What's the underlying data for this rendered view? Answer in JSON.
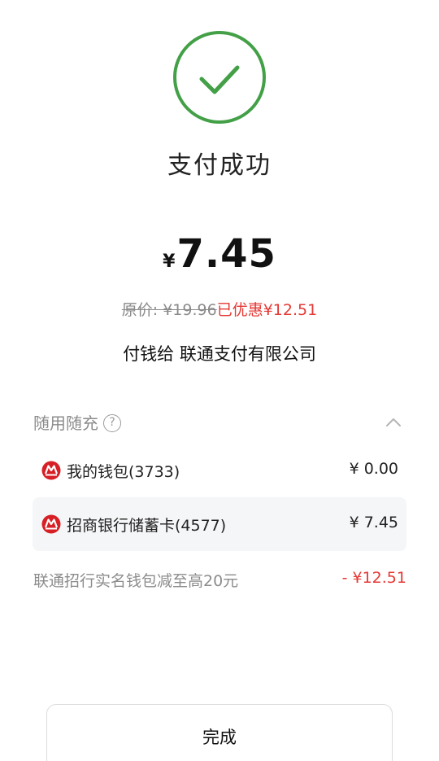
{
  "status": {
    "title": "支付成功",
    "icon": "check-circle-icon",
    "color": "#43a047"
  },
  "payment": {
    "currency_symbol": "¥",
    "amount": "7.45",
    "original_price_text": "原价: ¥19.96",
    "discount_text": "已优惠¥12.51",
    "payee_text": "付钱给 联通支付有限公司"
  },
  "method_section": {
    "title": "随用随充",
    "help_icon": "question-circle-icon",
    "collapse_icon": "chevron-up-icon",
    "methods": [
      {
        "name": "我的钱包(3733)",
        "amount": "¥ 0.00",
        "icon": "cmb-bank-logo-icon",
        "selected": false
      },
      {
        "name": "招商银行储蓄卡(4577)",
        "amount": "¥ 7.45",
        "icon": "cmb-bank-logo-icon",
        "selected": true
      }
    ],
    "promo_text": "联通招行实名钱包减至高20元",
    "promo_amount": "- ¥12.51"
  },
  "actions": {
    "done_label": "完成"
  },
  "colors": {
    "accent_red": "#e53935",
    "bank_red": "#d71f26",
    "success_green": "#43a047"
  }
}
